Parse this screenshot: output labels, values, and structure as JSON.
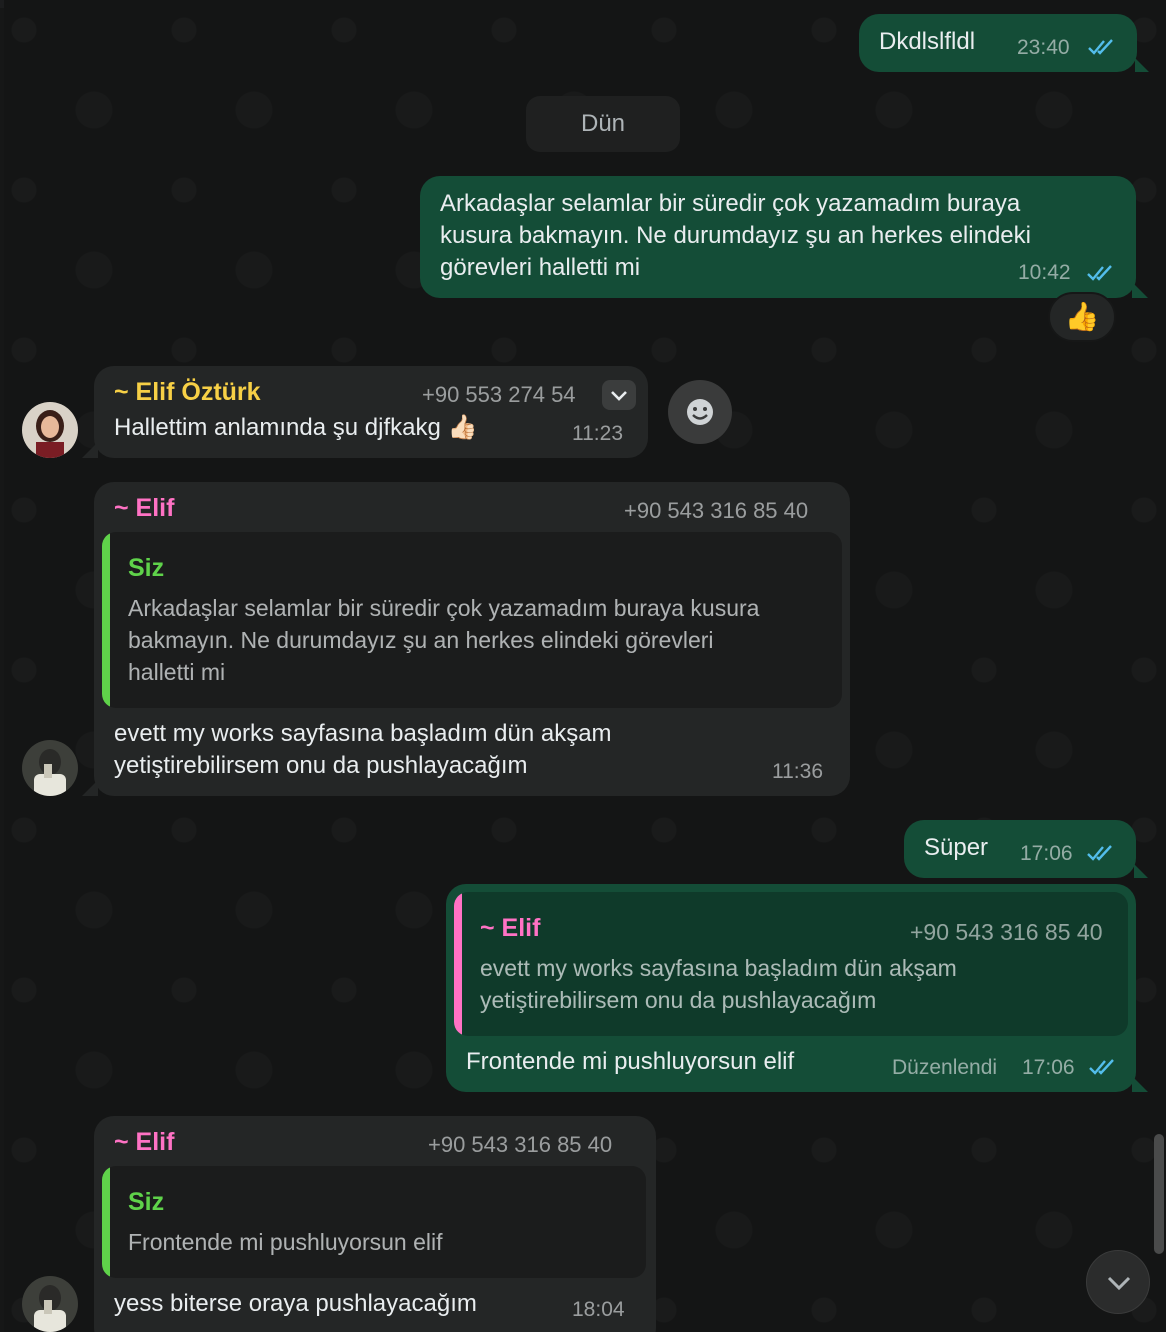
{
  "day_separator": "Dün",
  "messages": {
    "m1": {
      "text": "Dkdlslfldl",
      "time": "23:40"
    },
    "m2": {
      "line1": "Arkadaşlar selamlar bir süredir çok yazamadım buraya",
      "line2": "kusura bakmayın. Ne durumdayız şu an herkes elindeki",
      "line3": "görevleri halletti mi",
      "time": "10:42",
      "reaction": "👍"
    },
    "m3": {
      "sender": "~ Elif Öztürk",
      "phone": "+90 553 274 54",
      "text": "Hallettim anlamında şu djfkakg 👍🏻",
      "time": "11:23"
    },
    "m4": {
      "sender": "~ Elif",
      "phone": "+90 543 316 85 40",
      "quote_name": "Siz",
      "quote_line1": "Arkadaşlar selamlar bir süredir çok yazamadım buraya kusura",
      "quote_line2": "bakmayın. Ne durumdayız şu an herkes elindeki görevleri",
      "quote_line3": "halletti mi",
      "line1": "evett my works sayfasına başladım dün akşam",
      "line2": "yetiştirebilirsem onu da pushlayacağım",
      "time": "11:36"
    },
    "m5": {
      "text": "Süper",
      "time": "17:06"
    },
    "m6": {
      "quote_name": "~ Elif",
      "quote_phone": "+90 543 316 85 40",
      "quote_line1": "evett my works sayfasına başladım dün akşam",
      "quote_line2": "yetiştirebilirsem onu da pushlayacağım",
      "text": "Frontende mi pushluyorsun elif",
      "edited": "Düzenlendi",
      "time": "17:06"
    },
    "m7": {
      "sender": "~ Elif",
      "phone": "+90 543 316 85 40",
      "quote_name": "Siz",
      "quote_text": "Frontende mi pushluyorsun elif",
      "text": "yess biterse oraya pushlayacağım",
      "time": "18:04"
    }
  },
  "colors": {
    "outgoing_bubble": "#144d37",
    "incoming_bubble": "#242626",
    "sender_yellow": "#f7d046",
    "sender_pink": "#ff72c4",
    "quote_self_green": "#5fd24a",
    "read_ticks": "#53bdeb"
  },
  "icons": {
    "read_receipt": "double-check-icon",
    "emoji_button": "smiley-icon",
    "menu_chevron": "chevron-down-icon",
    "scroll_down": "chevron-down-icon"
  }
}
